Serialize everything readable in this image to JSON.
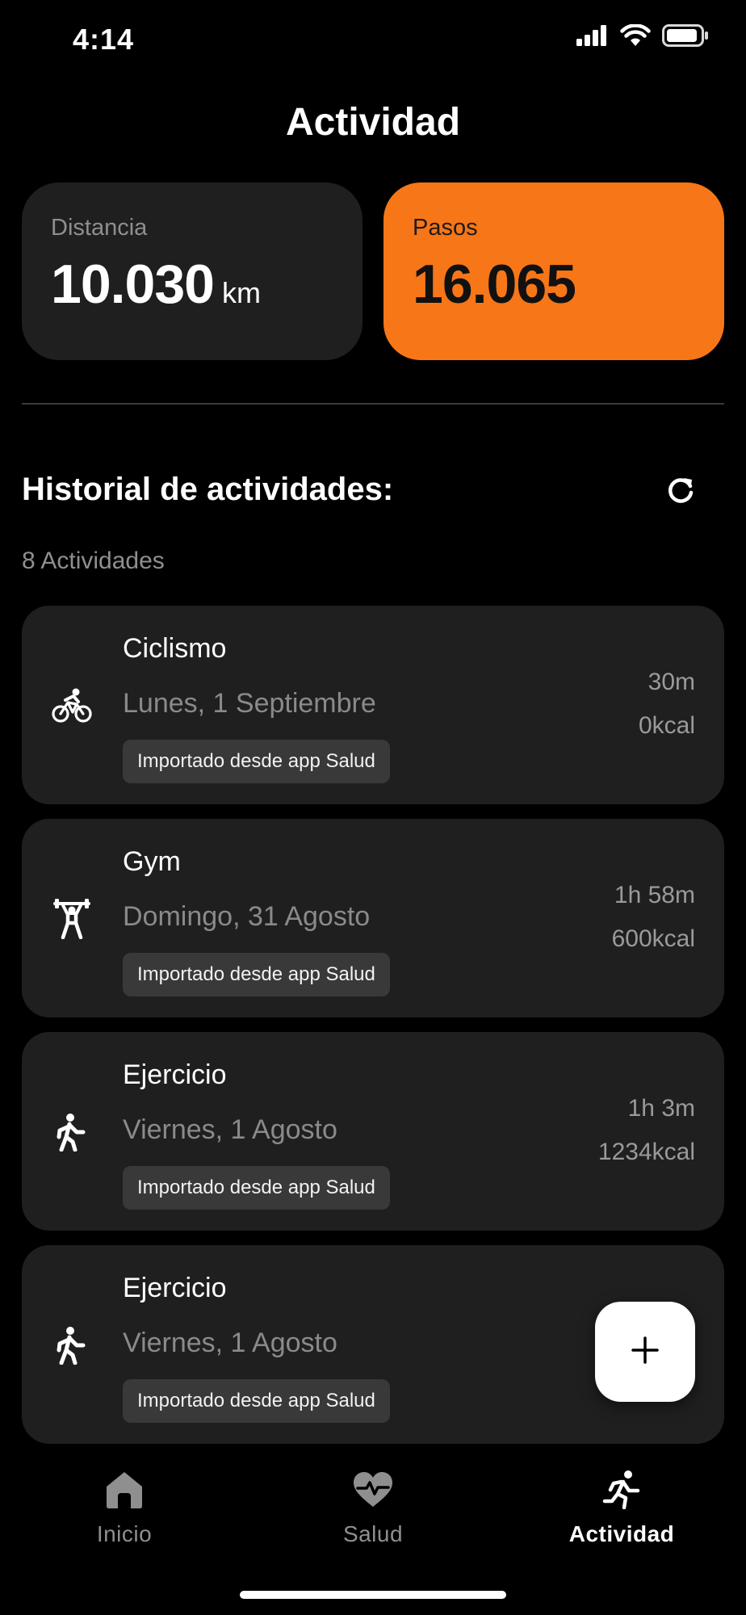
{
  "status_bar": {
    "time": "4:14",
    "icons": [
      "signal-icon",
      "wifi-icon",
      "battery-icon"
    ]
  },
  "header": {
    "title": "Actividad"
  },
  "stats": {
    "distance": {
      "label": "Distancia",
      "value": "10.030",
      "unit": "km"
    },
    "steps": {
      "label": "Pasos",
      "value": "16.065",
      "color": "#f77618"
    }
  },
  "history": {
    "title": "Historial de actividades:",
    "count_text": "8 Actividades",
    "refresh_icon": "refresh-icon",
    "items": [
      {
        "name": "Ciclismo",
        "date": "Lunes, 1 Septiembre",
        "tag": "Importado desde app Salud",
        "duration": "30m",
        "kcal": "0kcal",
        "icon": "cycling-icon"
      },
      {
        "name": "Gym",
        "date": "Domingo, 31 Agosto",
        "tag": "Importado desde app Salud",
        "duration": "1h 58m",
        "kcal": "600kcal",
        "icon": "weightlifting-icon"
      },
      {
        "name": "Ejercicio",
        "date": "Viernes, 1 Agosto",
        "tag": "Importado desde app Salud",
        "duration": "1h 3m",
        "kcal": "1234kcal",
        "icon": "walking-icon"
      },
      {
        "name": "Ejercicio",
        "date": "Viernes, 1 Agosto",
        "tag": "Importado desde app Salud",
        "icon": "walking-icon"
      }
    ]
  },
  "fab": {
    "icon": "plus-icon"
  },
  "nav": {
    "items": [
      {
        "label": "Inicio",
        "icon": "home-icon",
        "active": false
      },
      {
        "label": "Salud",
        "icon": "heart-pulse-icon",
        "active": false
      },
      {
        "label": "Actividad",
        "icon": "running-icon",
        "active": true
      }
    ]
  },
  "colors": {
    "background": "#000000",
    "card": "#1f1f1f",
    "accent": "#f77618",
    "muted_text": "#8f8f8f"
  }
}
